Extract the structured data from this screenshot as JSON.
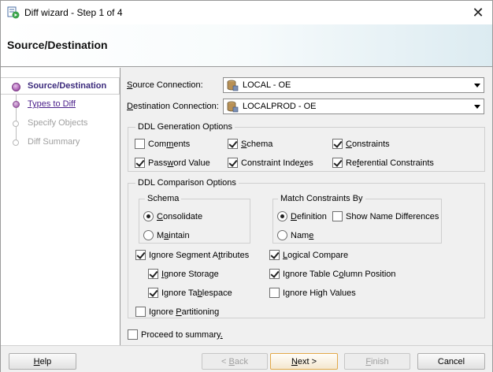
{
  "window": {
    "title": "Diff wizard - Step 1 of 4",
    "close_glyph": "✕"
  },
  "header": {
    "title": "Source/Destination"
  },
  "steps": [
    {
      "label": "Source/Destination",
      "state": "active"
    },
    {
      "label": "Types to Diff",
      "state": "visited"
    },
    {
      "label": "Specify Objects",
      "state": "disabled"
    },
    {
      "label": "Diff Summary",
      "state": "disabled"
    }
  ],
  "source": {
    "label_prefix": "S",
    "label_rest": "ource Connection:",
    "value": "LOCAL - OE"
  },
  "destination": {
    "label_prefix": "D",
    "label_rest": "estination Connection:",
    "value": "LOCALPROD - OE"
  },
  "ddl_generation": {
    "legend": "DDL Generation Options",
    "options": [
      {
        "pre": "Com",
        "u": "m",
        "post": "ents",
        "checked": false
      },
      {
        "pre": "",
        "u": "S",
        "post": "chema",
        "checked": true
      },
      {
        "pre": "",
        "u": "C",
        "post": "onstraints",
        "checked": true
      },
      {
        "pre": "Pass",
        "u": "w",
        "post": "ord Value",
        "checked": true
      },
      {
        "pre": "Constraint Inde",
        "u": "x",
        "post": "es",
        "checked": true
      },
      {
        "pre": "Re",
        "u": "f",
        "post": "erential Constraints",
        "checked": true
      }
    ]
  },
  "ddl_comparison": {
    "legend": "DDL Comparison Options",
    "schema": {
      "legend": "Schema",
      "options": [
        {
          "pre": "",
          "u": "C",
          "post": "onsolidate",
          "checked": true
        },
        {
          "pre": "M",
          "u": "a",
          "post": "intain",
          "checked": false
        }
      ]
    },
    "match": {
      "legend": "Match Constraints By",
      "options": [
        {
          "pre": "",
          "u": "D",
          "post": "efinition",
          "checked": true
        },
        {
          "pre": "Nam",
          "u": "e",
          "post": "",
          "checked": false
        }
      ],
      "show_name_diff": {
        "label": "Show Name Differences",
        "checked": false
      }
    },
    "checks": [
      {
        "pre": "Ignore Segment A",
        "u": "t",
        "post": "tributes",
        "checked": true
      },
      {
        "pre": "",
        "u": "L",
        "post": "ogical Compare",
        "checked": true
      },
      {
        "pre": "",
        "u": "I",
        "post": "gnore Storage",
        "checked": true
      },
      {
        "pre": "Ignore Table C",
        "u": "o",
        "post": "lumn Position",
        "checked": true
      },
      {
        "pre": "Ignore Ta",
        "u": "b",
        "post": "lespace",
        "checked": true
      },
      {
        "pre": "Ignore High Values",
        "u": "",
        "post": "",
        "checked": false
      },
      {
        "pre": "Ignore ",
        "u": "P",
        "post": "artitioning",
        "checked": false
      }
    ]
  },
  "proceed": {
    "pre": "Proceed to summary",
    "u": ".",
    "post": "",
    "checked": false
  },
  "buttons": {
    "help": {
      "pre": "",
      "u": "H",
      "post": "elp"
    },
    "back": {
      "pre": "< ",
      "u": "B",
      "post": "ack"
    },
    "next": {
      "pre": "",
      "u": "N",
      "post": "ext >"
    },
    "finish": {
      "pre": "",
      "u": "F",
      "post": "inish"
    },
    "cancel": {
      "label": "Cancel"
    }
  },
  "colors": {
    "active_step": "#3b2a7c",
    "link_step": "#4a1f8a",
    "next_border": "#e2a94a"
  },
  "icons": {
    "app": "wizard-icon",
    "connection": "database-connection-icon"
  }
}
